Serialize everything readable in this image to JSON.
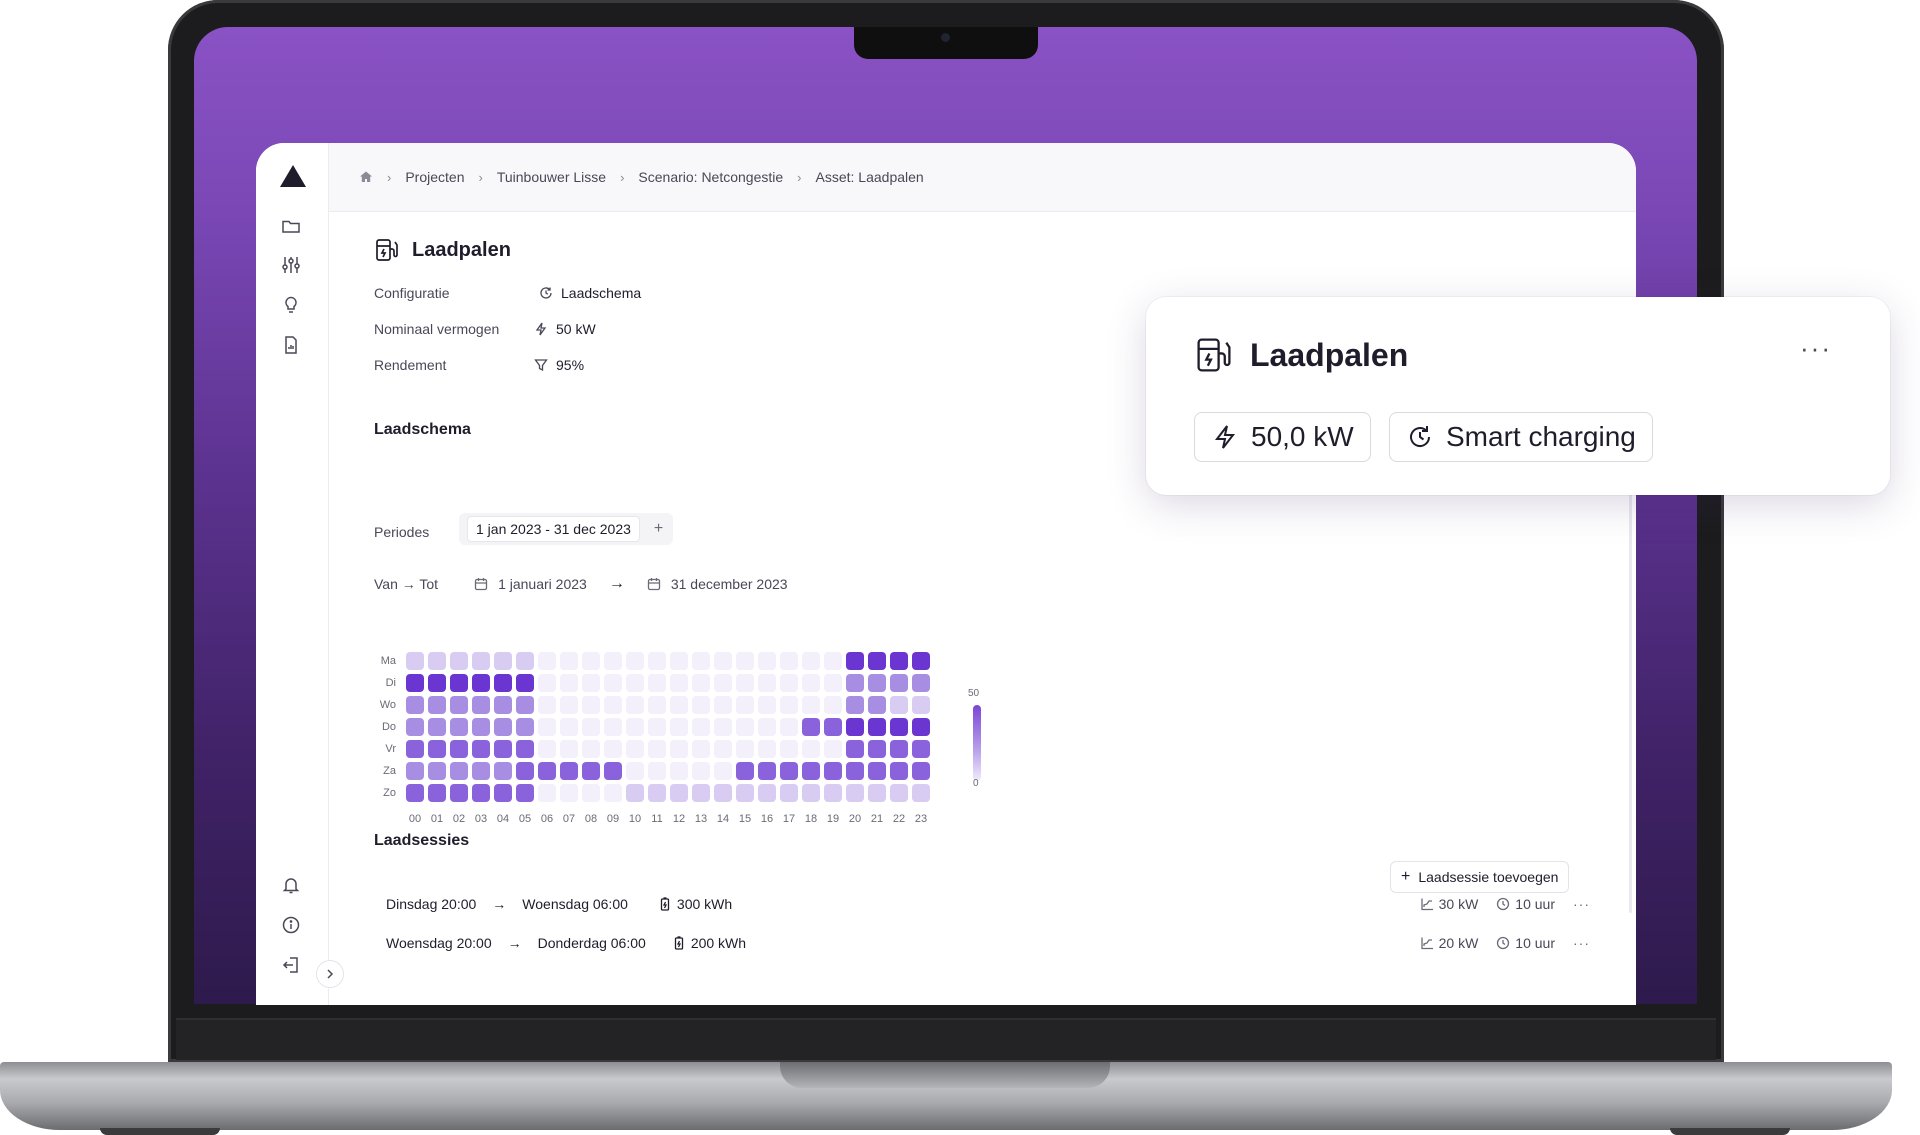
{
  "breadcrumb": [
    "Projecten",
    "Tuinbouwer Lisse",
    "Scenario: Netcongestie",
    "Asset: Laadpalen"
  ],
  "asset": {
    "title": "Laadpalen",
    "properties": [
      {
        "label": "Configuratie",
        "value": "Laadschema",
        "icon": "schedule-icon"
      },
      {
        "label": "Nominaal vermogen",
        "value": "50 kW",
        "icon": "lightning-icon"
      },
      {
        "label": "Rendement",
        "value": "95%",
        "icon": "funnel-icon"
      }
    ]
  },
  "schedule": {
    "title": "Laadschema",
    "periods_label": "Periodes",
    "period": "1 jan 2023 - 31 dec 2023",
    "add_symbol": "+",
    "range_label": "Van → Tot",
    "from": "1 januari 2023",
    "to": "31 december 2023"
  },
  "heatmap": {
    "days": [
      "Ma",
      "Di",
      "Wo",
      "Do",
      "Vr",
      "Za",
      "Zo"
    ],
    "hours": [
      "00",
      "01",
      "02",
      "03",
      "04",
      "05",
      "06",
      "07",
      "08",
      "09",
      "10",
      "11",
      "12",
      "13",
      "14",
      "15",
      "16",
      "17",
      "18",
      "19",
      "20",
      "21",
      "22",
      "23"
    ],
    "levels": [
      [
        1,
        1,
        1,
        1,
        1,
        1,
        0,
        0,
        0,
        0,
        0,
        0,
        0,
        0,
        0,
        0,
        0,
        0,
        0,
        0,
        4,
        4,
        4,
        4
      ],
      [
        4,
        4,
        4,
        4,
        4,
        4,
        0,
        0,
        0,
        0,
        0,
        0,
        0,
        0,
        0,
        0,
        0,
        0,
        0,
        0,
        2,
        2,
        2,
        2
      ],
      [
        2,
        2,
        2,
        2,
        2,
        2,
        0,
        0,
        0,
        0,
        0,
        0,
        0,
        0,
        0,
        0,
        0,
        0,
        0,
        0,
        2,
        2,
        1,
        1
      ],
      [
        2,
        2,
        2,
        2,
        2,
        2,
        0,
        0,
        0,
        0,
        0,
        0,
        0,
        0,
        0,
        0,
        0,
        0,
        3,
        3,
        4,
        4,
        4,
        4
      ],
      [
        3,
        3,
        3,
        3,
        3,
        3,
        0,
        0,
        0,
        0,
        0,
        0,
        0,
        0,
        0,
        0,
        0,
        0,
        0,
        0,
        3,
        3,
        3,
        3
      ],
      [
        2,
        2,
        2,
        2,
        2,
        3,
        3,
        3,
        3,
        3,
        0,
        0,
        0,
        0,
        0,
        3,
        3,
        3,
        3,
        3,
        3,
        3,
        3,
        3
      ],
      [
        3,
        3,
        3,
        3,
        3,
        3,
        0,
        0,
        0,
        0,
        1,
        1,
        1,
        1,
        1,
        1,
        1,
        1,
        1,
        1,
        1,
        1,
        1,
        1
      ]
    ],
    "colors": [
      "#f3f0fb",
      "#d9ccf3",
      "#a88ee3",
      "#8a63dc",
      "#6b35d1"
    ],
    "legend_max": "50",
    "legend_min": "0"
  },
  "sessions": {
    "title": "Laadsessies",
    "add_label": "Laadsessie toevoegen",
    "items": [
      {
        "from": "Dinsdag 20:00",
        "to": "Woensdag 06:00",
        "energy": "300 kWh",
        "power": "30 kW",
        "duration": "10 uur"
      },
      {
        "from": "Woensdag 20:00",
        "to": "Donderdag 06:00",
        "energy": "200 kWh",
        "power": "20 kW",
        "duration": "10 uur"
      }
    ]
  },
  "card": {
    "title": "Laadpalen",
    "power": "50,0 kW",
    "mode": "Smart charging",
    "more": "···"
  }
}
